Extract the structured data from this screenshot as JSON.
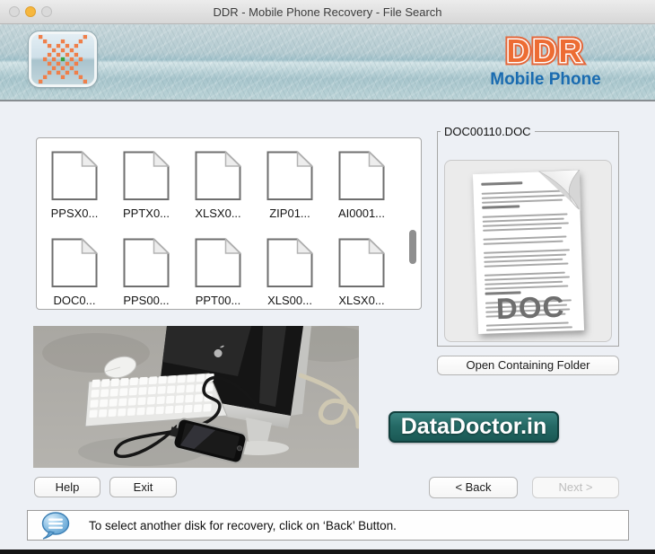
{
  "window": {
    "title": "DDR - Mobile Phone Recovery - File Search"
  },
  "header": {
    "brand": "DDR",
    "subtitle": "Mobile Phone"
  },
  "file_list": {
    "items": [
      "PPSX0...",
      "PPTX0...",
      "XLSX0...",
      "ZIP01...",
      "AI0001...",
      "DOC0...",
      "PPS00...",
      "PPT00...",
      "XLS00...",
      "XLSX0..."
    ]
  },
  "preview": {
    "group_title": "DOC00110.DOC",
    "doc_label": "DOC",
    "open_button": "Open Containing Folder"
  },
  "branding": {
    "site": "DataDoctor.in"
  },
  "buttons": {
    "help": "Help",
    "exit": "Exit",
    "back": "< Back",
    "next": "Next >"
  },
  "statusbar": {
    "message": "To select another disk for recovery, click on ‘Back’ Button."
  },
  "icons": {
    "logo": "checkered-star-logo",
    "status": "speech-bubble-icon",
    "files": "blank-document-icon"
  },
  "colors": {
    "accent_orange": "#ed6c33",
    "brand_blue": "#1a6bb0",
    "badge_teal": "#1a5855",
    "banner_teal": "#aac7ce",
    "content_bg": "#edf0f5"
  }
}
